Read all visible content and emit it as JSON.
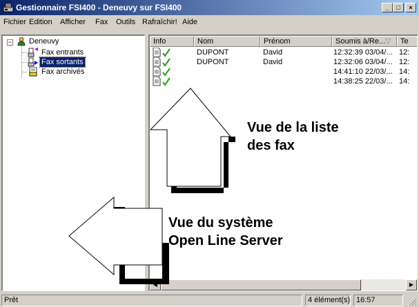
{
  "window": {
    "title": "Gestionnaire FSI400 - Deneuvy sur FSI400",
    "minimize_glyph": "_",
    "maximize_glyph": "□",
    "close_glyph": "×"
  },
  "menu": {
    "items": [
      {
        "label": "Fichier"
      },
      {
        "label": "Edition"
      },
      {
        "label": "Afficher"
      },
      {
        "label": "Fax"
      },
      {
        "label": "Outils"
      },
      {
        "label": "Rafraîchir!"
      },
      {
        "label": "Aide"
      }
    ]
  },
  "tree": {
    "root": {
      "label": "Deneuvy",
      "expander": "−"
    },
    "children": [
      {
        "label": "Fax entrants",
        "icon": "fax-incoming-icon"
      },
      {
        "label": "Fax sortants",
        "icon": "fax-outgoing-icon",
        "selected": true
      },
      {
        "label": "Fax archivés",
        "icon": "fax-archive-icon"
      }
    ]
  },
  "list": {
    "columns": [
      {
        "label": "Info"
      },
      {
        "label": "Nom"
      },
      {
        "label": "Prénom"
      },
      {
        "label": "Soumis à/Re...",
        "sort_glyph": "▽"
      },
      {
        "label": "Te"
      }
    ],
    "rows": [
      {
        "nom": "DUPONT",
        "prenom": "David",
        "soumis": "12:32:39 03/04/...",
        "extra": "12:"
      },
      {
        "nom": "DUPONT",
        "prenom": "David",
        "soumis": "12:32:06 03/04/...",
        "extra": "12:"
      },
      {
        "nom": "",
        "prenom": "",
        "soumis": "14:41:10 22/03/...",
        "extra": "14:"
      },
      {
        "nom": "",
        "prenom": "",
        "soumis": "14:38:25 22/03/...",
        "extra": "14:"
      }
    ]
  },
  "annotations": {
    "list_view": [
      "Vue de la liste",
      "des fax"
    ],
    "system_view": [
      "Vue du système",
      "Open Line Server"
    ]
  },
  "status": {
    "text": "Prêt",
    "count": "4 élément(s)",
    "time": "16:57"
  },
  "colors": {
    "title_start": "#0a246a",
    "title_end": "#a6caf0",
    "selection": "#0a246a",
    "checkmark": "#2a9a1a",
    "flag_incoming": "#c000c0",
    "flag_outgoing": "#0000ff"
  }
}
